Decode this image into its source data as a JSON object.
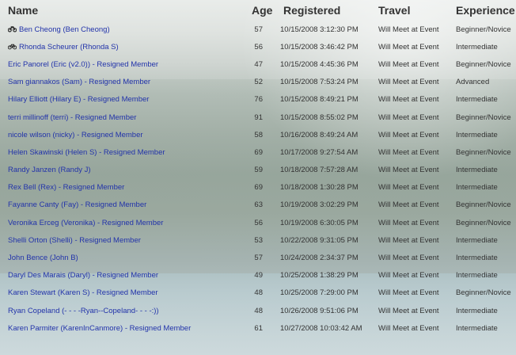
{
  "headers": {
    "name": "Name",
    "age": "Age",
    "registered": "Registered",
    "travel": "Travel",
    "experience": "Experience"
  },
  "rows": [
    {
      "name": "Ben Cheong (Ben Cheong)",
      "icon": "motorcycle-icon",
      "age": "57",
      "registered": "10/15/2008 3:12:30 PM",
      "travel": "Will Meet at Event",
      "experience": "Beginner/Novice"
    },
    {
      "name": "Rhonda Scheurer (Rhonda S)",
      "icon": "bicycle-icon",
      "age": "56",
      "registered": "10/15/2008 3:46:42 PM",
      "travel": "Will Meet at Event",
      "experience": "Intermediate"
    },
    {
      "name": "Eric Panorel (Eric (v2.0)) - Resigned Member",
      "icon": "",
      "age": "47",
      "registered": "10/15/2008 4:45:36 PM",
      "travel": "Will Meet at Event",
      "experience": "Beginner/Novice"
    },
    {
      "name": "Sam giannakos (Sam) - Resigned Member",
      "icon": "",
      "age": "52",
      "registered": "10/15/2008 7:53:24 PM",
      "travel": "Will Meet at Event",
      "experience": "Advanced"
    },
    {
      "name": "Hilary Elliott (Hilary E) - Resigned Member",
      "icon": "",
      "age": "76",
      "registered": "10/15/2008 8:49:21 PM",
      "travel": "Will Meet at Event",
      "experience": "Intermediate"
    },
    {
      "name": "terri millinoff (terri) - Resigned Member",
      "icon": "",
      "age": "91",
      "registered": "10/15/2008 8:55:02 PM",
      "travel": "Will Meet at Event",
      "experience": "Beginner/Novice"
    },
    {
      "name": "nicole wilson (nicky) - Resigned Member",
      "icon": "",
      "age": "58",
      "registered": "10/16/2008 8:49:24 AM",
      "travel": "Will Meet at Event",
      "experience": "Intermediate"
    },
    {
      "name": "Helen Skawinski (Helen S) - Resigned Member",
      "icon": "",
      "age": "69",
      "registered": "10/17/2008 9:27:54 AM",
      "travel": "Will Meet at Event",
      "experience": "Beginner/Novice"
    },
    {
      "name": "Randy Janzen (Randy J)",
      "icon": "",
      "age": "59",
      "registered": "10/18/2008 7:57:28 AM",
      "travel": "Will Meet at Event",
      "experience": "Intermediate"
    },
    {
      "name": "Rex Bell (Rex) - Resigned Member",
      "icon": "",
      "age": "69",
      "registered": "10/18/2008 1:30:28 PM",
      "travel": "Will Meet at Event",
      "experience": "Intermediate"
    },
    {
      "name": "Fayanne Canty (Fay) - Resigned Member",
      "icon": "",
      "age": "63",
      "registered": "10/19/2008 3:02:29 PM",
      "travel": "Will Meet at Event",
      "experience": "Beginner/Novice"
    },
    {
      "name": "Veronika Erceg (Veronika) - Resigned Member",
      "icon": "",
      "age": "56",
      "registered": "10/19/2008 6:30:05 PM",
      "travel": "Will Meet at Event",
      "experience": "Beginner/Novice"
    },
    {
      "name": "Shelli Orton (Shelli) - Resigned Member",
      "icon": "",
      "age": "53",
      "registered": "10/22/2008 9:31:05 PM",
      "travel": "Will Meet at Event",
      "experience": "Intermediate"
    },
    {
      "name": "John Bence (John B)",
      "icon": "",
      "age": "57",
      "registered": "10/24/2008 2:34:37 PM",
      "travel": "Will Meet at Event",
      "experience": "Intermediate"
    },
    {
      "name": "Daryl Des Marais (Daryl) - Resigned Member",
      "icon": "",
      "age": "49",
      "registered": "10/25/2008 1:38:29 PM",
      "travel": "Will Meet at Event",
      "experience": "Intermediate"
    },
    {
      "name": "Karen Stewart (Karen S) - Resigned Member",
      "icon": "",
      "age": "48",
      "registered": "10/25/2008 7:29:00 PM",
      "travel": "Will Meet at Event",
      "experience": "Beginner/Novice"
    },
    {
      "name": "Ryan Copeland (- - - -Ryan--Copeland- - - -:))",
      "icon": "",
      "age": "48",
      "registered": "10/26/2008 9:51:06 PM",
      "travel": "Will Meet at Event",
      "experience": "Intermediate"
    },
    {
      "name": "Karen Parmiter (KarenInCanmore) - Resigned Member",
      "icon": "",
      "age": "61",
      "registered": "10/27/2008 10:03:42 AM",
      "travel": "Will Meet at Event",
      "experience": "Intermediate"
    }
  ],
  "colors": {
    "link": "#2233aa",
    "text": "#333333",
    "header": "#333333"
  }
}
